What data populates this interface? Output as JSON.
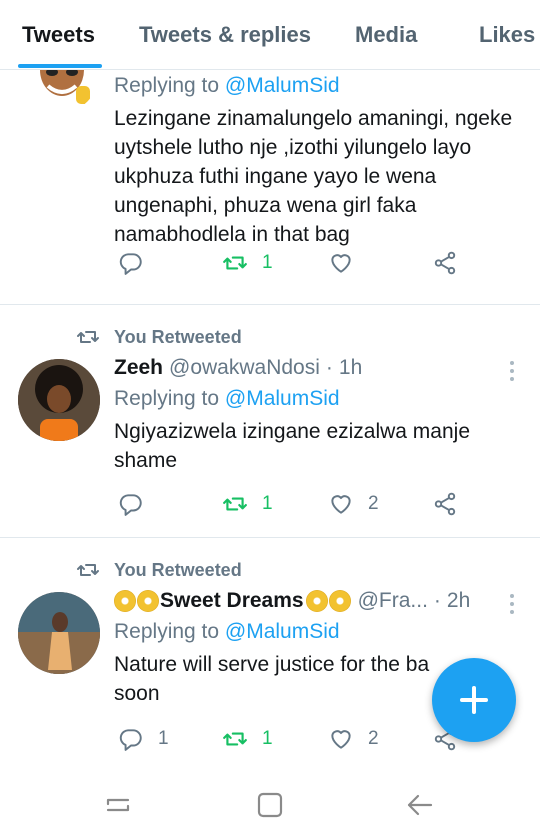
{
  "tabs": [
    {
      "label": "Tweets",
      "active": true
    },
    {
      "label": "Tweets & replies",
      "active": false
    },
    {
      "label": "Media",
      "active": false
    },
    {
      "label": "Likes",
      "active": false
    }
  ],
  "tweets": [
    {
      "retweeted_by": "",
      "name": "",
      "handle": "",
      "time": "",
      "reply_prefix": "Replying to",
      "reply_to": "@MalumSid",
      "text": "Lezingane zinamalungelo amaningi, ngeke uytshele lutho nje ,izothi yilungelo layo ukphuza futhi ingane yayo le wena ungenaphi, phuza wena girl faka namabhodlela in that bag",
      "replies": "",
      "retweets": "1",
      "likes": ""
    },
    {
      "retweeted_by": "You Retweeted",
      "name": "Zeeh",
      "handle": "@owakwaNdosi",
      "time": "1h",
      "reply_prefix": "Replying to",
      "reply_to": "@MalumSid",
      "text": "Ngiyazizwela izingane ezizalwa manje shame",
      "replies": "",
      "retweets": "1",
      "likes": "2"
    },
    {
      "retweeted_by": "You Retweeted",
      "name": "Sweet Dreams",
      "handle": "@Fra...",
      "time": "2h",
      "reply_prefix": "Replying to",
      "reply_to": "@MalumSid",
      "text": "Nature will serve justice for the ba",
      "text_line2": "soon",
      "replies": "1",
      "retweets": "1",
      "likes": "2"
    }
  ],
  "colors": {
    "accent": "#1da1f2",
    "retweet_active": "#17bf63",
    "secondary_text": "#657786",
    "divider": "#e1e8ed"
  },
  "icons": {
    "reply": "reply-icon",
    "retweet": "retweet-icon",
    "like": "heart-icon",
    "share": "share-icon",
    "compose": "compose-plus-icon",
    "nav_recents": "recent-apps-icon",
    "nav_home": "home-icon",
    "nav_back": "back-icon"
  }
}
